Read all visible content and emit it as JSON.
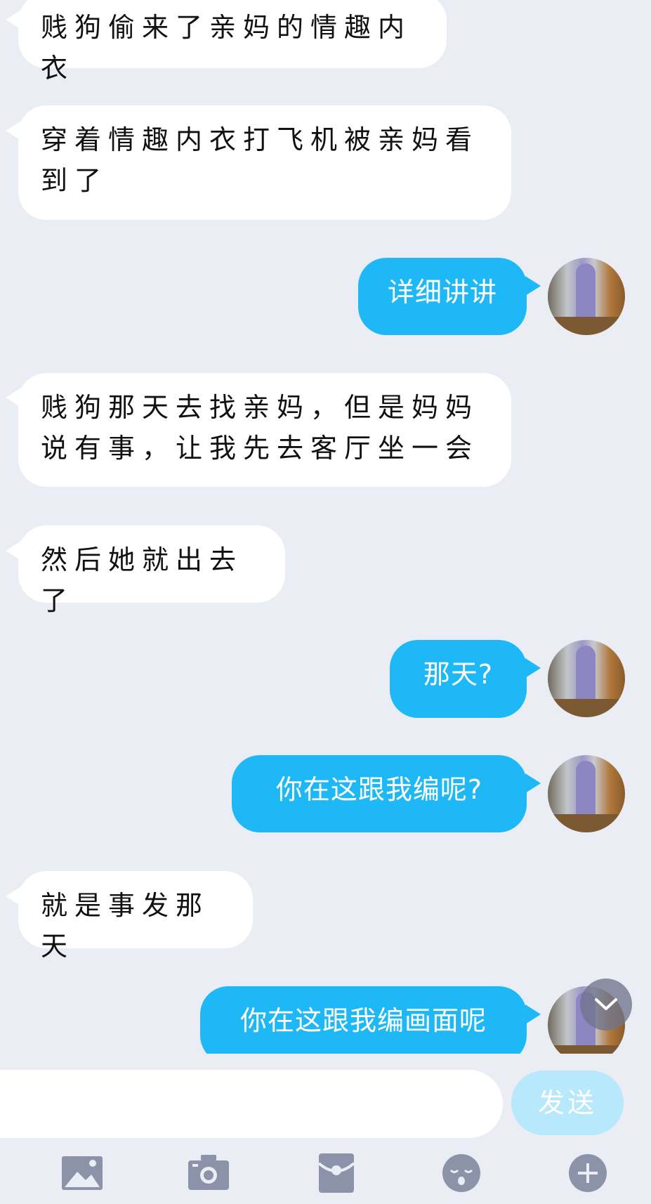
{
  "messages": [
    {
      "side": "in",
      "text": "贱狗偷来了亲妈的情趣内衣"
    },
    {
      "side": "in",
      "text": "穿着情趣内衣打飞机被亲妈看到了"
    },
    {
      "side": "out",
      "text": "详细讲讲"
    },
    {
      "side": "in",
      "text": "贱狗那天去找亲妈，但是妈妈说有事，让我先去客厅坐一会"
    },
    {
      "side": "in",
      "text": "然后她就出去了"
    },
    {
      "side": "out",
      "text": "那天?"
    },
    {
      "side": "out",
      "text": "你在这跟我编呢?"
    },
    {
      "side": "in",
      "text": "就是事发那天"
    },
    {
      "side": "out",
      "text": "你在这跟我编画面呢"
    }
  ],
  "composer": {
    "input_value": "",
    "send_label": "发送"
  },
  "toolbar": {
    "items": [
      "image-icon",
      "camera-icon",
      "red-packet-icon",
      "emoji-icon",
      "plus-icon"
    ]
  },
  "colors": {
    "background": "#eaedf4",
    "outgoing_bubble": "#1fb8f6",
    "incoming_bubble": "#ffffff",
    "send_button": "#b8e8fb",
    "icon": "#8c93a8"
  }
}
